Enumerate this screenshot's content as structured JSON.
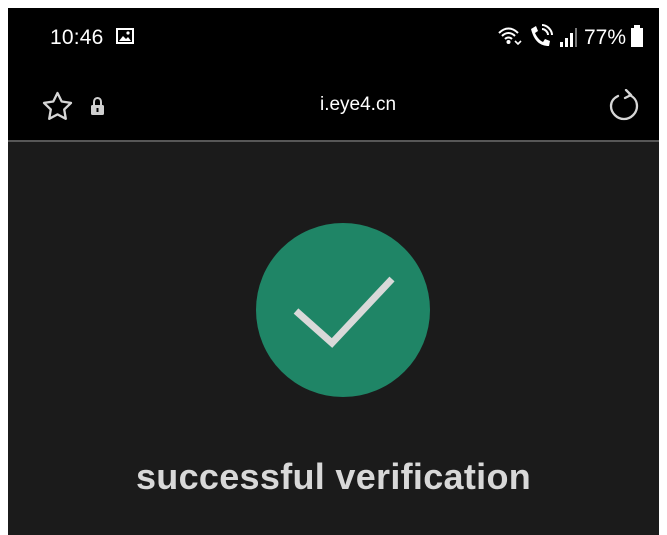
{
  "status_bar": {
    "time": "10:46",
    "battery": "77%",
    "icons": [
      "gallery-icon",
      "wifi-icon",
      "wifi-calling-icon",
      "signal-icon",
      "battery-icon"
    ]
  },
  "browser": {
    "url": "i.eye4.cn",
    "icons": [
      "star-icon",
      "lock-icon",
      "refresh-icon"
    ]
  },
  "page": {
    "message": "successful verification",
    "success_color": "#1f8566",
    "check_icon": "checkmark-icon"
  },
  "colors": {
    "status_background": "#000000",
    "page_background": "#1b1b1b",
    "message_color": "#d8d8d8"
  }
}
